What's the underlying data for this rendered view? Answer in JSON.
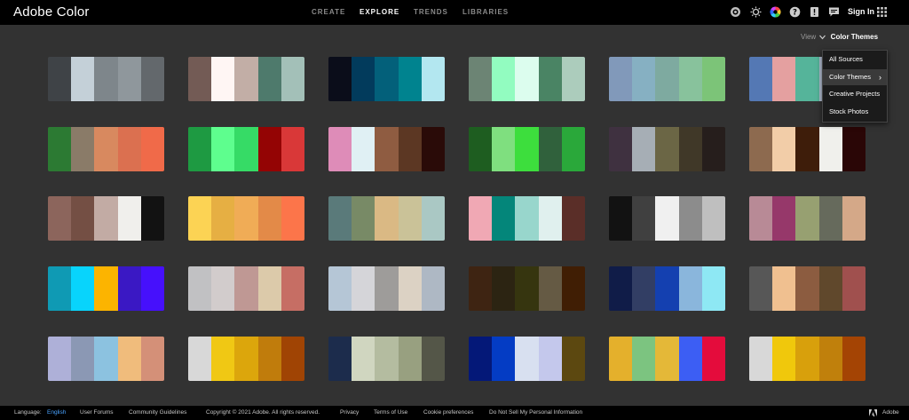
{
  "app": {
    "title": "Adobe Color"
  },
  "nav": {
    "items": [
      "CREATE",
      "EXPLORE",
      "TRENDS",
      "LIBRARIES"
    ],
    "active": "EXPLORE"
  },
  "header": {
    "signin": "Sign In"
  },
  "view": {
    "label": "View",
    "value": "Color Themes"
  },
  "dropdown": {
    "items": [
      "All Sources",
      "Color Themes",
      "Creative Projects",
      "Stock Photos"
    ],
    "selected": "Color Themes"
  },
  "palettes": [
    [
      "#3f4347",
      "#c4d0d8",
      "#7e868b",
      "#8f979c",
      "#63686c"
    ],
    [
      "#735b55",
      "#fff6f4",
      "#c2aea6",
      "#4e7a6c",
      "#a3c0b8"
    ],
    [
      "#0b0d1a",
      "#023b5c",
      "#03607a",
      "#00838f",
      "#b3e7f0"
    ],
    [
      "#6c8474",
      "#92fcc0",
      "#dcfdee",
      "#4a8464",
      "#acccbc"
    ],
    [
      "#8199ba",
      "#86b0c2",
      "#7eaaa0",
      "#88c29c",
      "#7cc478"
    ],
    [
      "#5478b4",
      "#e4a0a0",
      "#55b49a",
      "#b4c0d4",
      "#dde4e6"
    ],
    [
      "#2c7a33",
      "#8a7b68",
      "#d8895f",
      "#db7050",
      "#f06a49"
    ],
    [
      "#1e9a42",
      "#5efe8e",
      "#36db66",
      "#940404",
      "#d93838"
    ],
    [
      "#de8cb8",
      "#e0f0f4",
      "#8f5c41",
      "#5c3723",
      "#2a0b08"
    ],
    [
      "#1e5d20",
      "#7fdf7f",
      "#3dde3d",
      "#30613c",
      "#2aa83a"
    ],
    [
      "#3f3140",
      "#a6aeb5",
      "#6b6645",
      "#403828",
      "#261e1c"
    ],
    [
      "#8d6a4f",
      "#f2cda8",
      "#3e1d0a",
      "#f0f0ec",
      "#2a0606"
    ],
    [
      "#8c655c",
      "#744f44",
      "#c2aba4",
      "#f0efec",
      "#121212"
    ],
    [
      "#fcd354",
      "#e6af43",
      "#f0ac56",
      "#e38a48",
      "#fc754a"
    ],
    [
      "#5a7a7a",
      "#788a66",
      "#dab984",
      "#cac298",
      "#aac8c4"
    ],
    [
      "#f0a8b4",
      "#04867a",
      "#98d6cc",
      "#e0f0ee",
      "#5a2e28"
    ],
    [
      "#121212",
      "#404040",
      "#f0f0f0",
      "#8c8c8c",
      "#bfbfbf"
    ],
    [
      "#b88a96",
      "#96386a",
      "#97a071",
      "#666a5c",
      "#d4a888"
    ],
    [
      "#0f9ab4",
      "#08d4fc",
      "#fcb400",
      "#3a18c4",
      "#4610fc"
    ],
    [
      "#c1c1c3",
      "#d2cccc",
      "#bf9894",
      "#dccaaa",
      "#c66e64"
    ],
    [
      "#b5c6d6",
      "#d5d5d9",
      "#9e9c9a",
      "#dcd2c4",
      "#aeb8c4"
    ],
    [
      "#3e2412",
      "#2c2412",
      "#36350f",
      "#655a44",
      "#401e04"
    ],
    [
      "#101c48",
      "#323e64",
      "#1440b0",
      "#8ab6dc",
      "#8ee8f4"
    ],
    [
      "#575757",
      "#f0c090",
      "#8c5c40",
      "#60482c",
      "#a0504e"
    ],
    [
      "#aeb0d8",
      "#8b98b4",
      "#8cc2e0",
      "#f0bc7c",
      "#d49078"
    ],
    [
      "#d8d8d8",
      "#f0c814",
      "#dca60c",
      "#c07c0c",
      "#a04404"
    ],
    [
      "#1c2c4c",
      "#d0d6c0",
      "#b4bca0",
      "#98a080",
      "#545648"
    ],
    [
      "#041878",
      "#043cc4",
      "#d8e0f0",
      "#c4c8ec",
      "#5c4810"
    ],
    [
      "#e4b02c",
      "#7cc480",
      "#e4b838",
      "#3c5ef4",
      "#e40c3c"
    ],
    [
      "#d8d8d8",
      "#f0c80c",
      "#d8a00c",
      "#c0800c",
      "#a44404"
    ]
  ],
  "footer": {
    "language_label": "Language:",
    "language_value": "English",
    "links": [
      "User Forums",
      "Community Guidelines",
      "Copyright © 2021 Adobe. All rights reserved.",
      "Privacy",
      "Terms of Use",
      "Cookie preferences",
      "Do Not Sell My Personal Information"
    ],
    "adobe": "Adobe"
  },
  "colors": {
    "accent": "#4aa3ff",
    "background": "#323232",
    "topbar": "#000000"
  },
  "icons": [
    "notifications-icon",
    "brightness-icon",
    "color-wheel-icon",
    "help-icon",
    "feedback-icon",
    "chat-icon",
    "apps-grid-icon",
    "adobe-logo-icon"
  ]
}
